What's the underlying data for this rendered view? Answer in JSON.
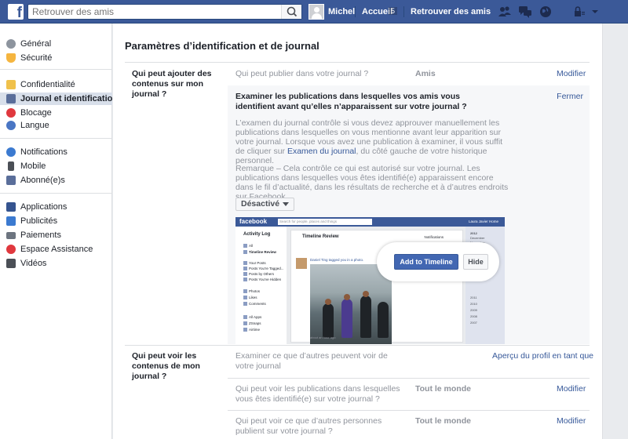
{
  "topbar": {
    "search_placeholder": "Retrouver des amis",
    "user_name": "Michel",
    "home_label": "Accueil",
    "home_count": "5",
    "find_friends_label": "Retrouver des amis",
    "colors": {
      "bar": "#3b5998"
    }
  },
  "sidebar": {
    "items": [
      {
        "label": "Général",
        "icon": "gear-icon"
      },
      {
        "label": "Sécurité",
        "icon": "shield-icon"
      },
      {
        "label": "Confidentialité",
        "icon": "padlock-icon"
      },
      {
        "label": "Journal et identification",
        "icon": "timeline-icon"
      },
      {
        "label": "Blocage",
        "icon": "block-icon"
      },
      {
        "label": "Langue",
        "icon": "globe-icon"
      },
      {
        "label": "Notifications",
        "icon": "earth-icon"
      },
      {
        "label": "Mobile",
        "icon": "phone-icon"
      },
      {
        "label": "Abonné(e)s",
        "icon": "rss-icon"
      },
      {
        "label": "Applications",
        "icon": "apps-icon"
      },
      {
        "label": "Publicités",
        "icon": "ads-icon"
      },
      {
        "label": "Paiements",
        "icon": "card-icon"
      },
      {
        "label": "Espace Assistance",
        "icon": "lifebuoy-icon"
      },
      {
        "label": "Vidéos",
        "icon": "film-icon"
      }
    ],
    "active_index": 3
  },
  "main": {
    "title": "Paramètres d’identification et de journal",
    "section1": {
      "heading": "Qui peut ajouter des contenus sur mon journal ?",
      "row1": {
        "question": "Qui peut publier dans votre journal ?",
        "value": "Amis",
        "action": "Modifier"
      },
      "expanded": {
        "title": "Examiner les publications dans lesquelles vos amis vous identifient avant qu’elles n’apparaissent sur votre journal ?",
        "close": "Fermer",
        "para1_before": "L’examen du journal contrôle si vous devez approuver manuellement les publications dans lesquelles on vous mentionne avant leur apparition sur votre journal. Lorsque vous avez une publication à examiner, il vous suffit de cliquer sur ",
        "para1_link": "Examen du journal",
        "para1_after": ", du côté gauche de votre historique personnel.",
        "para2": "Remarque – Cela contrôle ce qui est autorisé sur votre journal. Les publications dans lesquelles vous êtes identifié(e) apparaissent encore dans le fil d’actualité, dans les résultats de recherche et à d’autres endroits sur Facebook.",
        "dropdown": "Désactivé"
      },
      "illustration": {
        "logo": "facebook",
        "search": "Search for people, places and things",
        "user": "Laura Javier   Home",
        "left_title": "Activity Log",
        "left_items": [
          "All",
          "Timeline Review",
          "Your Posts",
          "Posts You're Tagged...",
          "Posts by Others",
          "Posts You've Hidden",
          "Photos",
          "Likes",
          "Comments",
          "All Apps",
          "ZSnaps",
          "Airtime"
        ],
        "card_title": "Timeline Review",
        "notifications": "Notifications",
        "post_text": "Daniel Ting tagged you in a photo.",
        "caption": "about an hour ago",
        "years": [
          "2012",
          "December",
          "November",
          "2011",
          "2010",
          "2009",
          "2008",
          "2007"
        ],
        "add_button": "Add to Timeline",
        "hide_button": "Hide"
      }
    },
    "section2": {
      "heading": "Qui peut voir les contenus de mon journal ?",
      "row1": {
        "question": "Examiner ce que d’autres peuvent voir de votre journal",
        "action": "Aperçu du profil en tant que"
      },
      "row2": {
        "question": "Qui peut voir les publications dans lesquelles vous êtes identifié(e) sur votre journal ?",
        "value": "Tout le monde",
        "action": "Modifier"
      },
      "row3": {
        "question": "Qui peut voir ce que d’autres personnes publient sur votre journal ?",
        "value": "Tout le monde",
        "action": "Modifier"
      }
    }
  }
}
